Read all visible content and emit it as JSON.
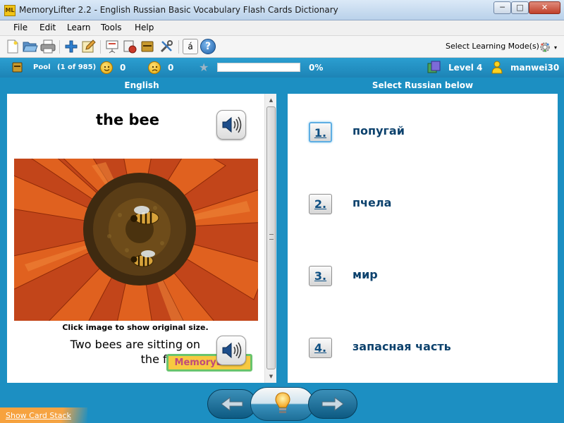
{
  "window": {
    "app_icon_text": "ML",
    "title": "MemoryLifter 2.2 - English Russian Basic Vocabulary Flash Cards Dictionary",
    "minimize": "─",
    "maximize": "□",
    "close": "✕"
  },
  "menu": [
    "File",
    "Edit",
    "Learn",
    "Tools",
    "Help"
  ],
  "toolbar": {
    "icons": [
      "new-file-icon",
      "open-folder-icon",
      "print-icon",
      "add-card-icon",
      "edit-card-icon",
      "presentation-icon",
      "card-manager-icon",
      "dictionary-icon",
      "settings-tools-icon",
      "character-map-icon",
      "help-icon"
    ],
    "character_map_glyph": "á",
    "help_glyph": "?",
    "learning_mode_label": "Select Learning Mode(s)",
    "learning_mode_caret": "▾"
  },
  "status": {
    "pool_label": "Pool",
    "pool_detail": "(1 of 985)",
    "correct_count": "0",
    "wrong_count": "0",
    "progress_percent_label": "0%",
    "progress_fraction": 0,
    "level": "Level 4",
    "user": "manwei30"
  },
  "question": {
    "header": "English",
    "word": "the bee",
    "image_caption": "Click image to show original size.",
    "example_sentence": "Two bees are sitting on the flower.",
    "logo_text": "MemoryLifter"
  },
  "answers": {
    "header": "Select Russian below",
    "options": [
      {
        "number": "1.",
        "text": "попугай"
      },
      {
        "number": "2.",
        "text": "пчела"
      },
      {
        "number": "3.",
        "text": "мир"
      },
      {
        "number": "4.",
        "text": "запасная часть"
      }
    ]
  },
  "scrollbar": {
    "up": "▲",
    "down": "▼"
  },
  "footer": {
    "show_card_stack": "Show Card Stack"
  },
  "colors": {
    "background": "#1c8fc2",
    "answer_text": "#0d426d",
    "progress_fill": "#46b04b",
    "card_stack_tab": "#f7a23d"
  }
}
